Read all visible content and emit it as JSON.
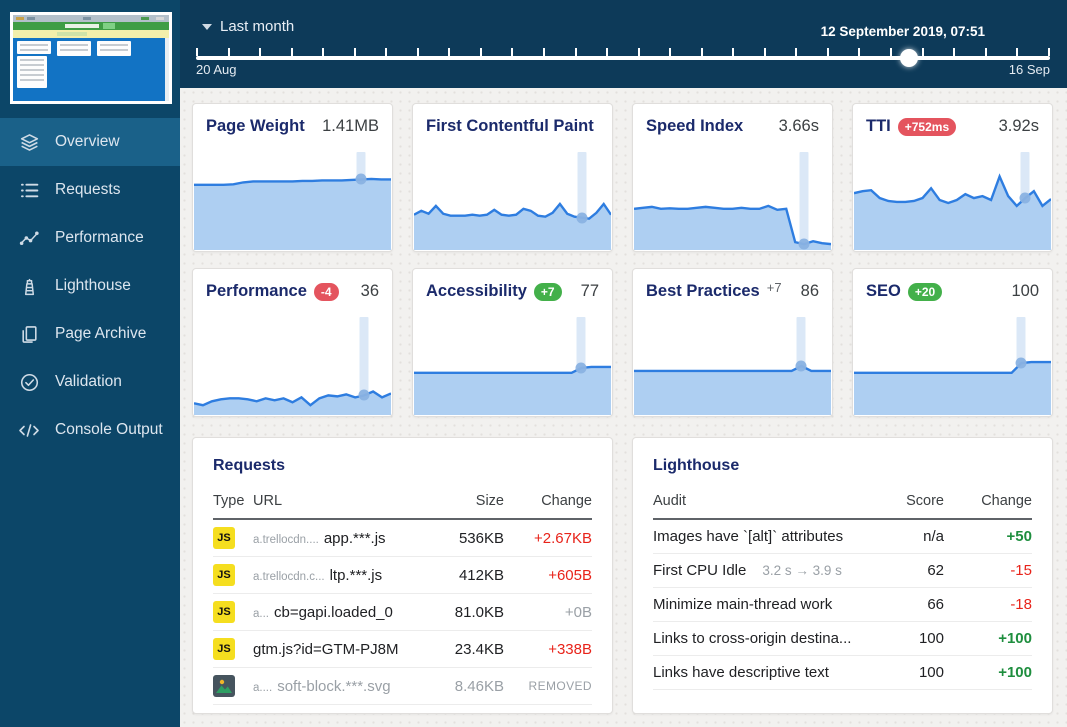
{
  "sidebar": {
    "items": [
      {
        "label": "Overview",
        "icon": "layers-icon",
        "active": true
      },
      {
        "label": "Requests",
        "icon": "list-icon",
        "active": false
      },
      {
        "label": "Performance",
        "icon": "scatter-icon",
        "active": false
      },
      {
        "label": "Lighthouse",
        "icon": "lighthouse-icon",
        "active": false
      },
      {
        "label": "Page Archive",
        "icon": "pages-icon",
        "active": false
      },
      {
        "label": "Validation",
        "icon": "check-circle-icon",
        "active": false
      },
      {
        "label": "Console Output",
        "icon": "code-icon",
        "active": false
      }
    ]
  },
  "header": {
    "range_label": "Last month",
    "current_datetime": "12 September 2019, 07:51",
    "range_start": "20 Aug",
    "range_end": "16 Sep",
    "slider_position_pct": 83.5
  },
  "colors": {
    "sidebar_bg": "#0c4668",
    "sidebar_active_bg": "#1a6189",
    "topbar_bg": "#0d3a59",
    "title_navy": "#1b2a6b",
    "spark_line": "#2e7de0",
    "spark_fill": "#aecff2",
    "badge_red": "#e4545e",
    "badge_green": "#43b04a",
    "change_red": "#e8231a",
    "change_green": "#1e8e3e",
    "js_badge_yellow": "#f5de1f"
  },
  "metric_cards": [
    {
      "title": "Page Weight",
      "value": "1.41MB",
      "badge": null,
      "chart": {
        "values": [
          0.335,
          0.335,
          0.335,
          0.335,
          0.33,
          0.31,
          0.3,
          0.3,
          0.3,
          0.3,
          0.3,
          0.295,
          0.295,
          0.29,
          0.29,
          0.29,
          0.285,
          0.28,
          0.275,
          0.28,
          0.28
        ],
        "marker_index": 17
      }
    },
    {
      "title": "First Contentful Paint",
      "value": "",
      "badge": null,
      "chart": {
        "values": [
          0.64,
          0.6,
          0.63,
          0.55,
          0.63,
          0.65,
          0.65,
          0.65,
          0.64,
          0.65,
          0.64,
          0.59,
          0.64,
          0.65,
          0.64,
          0.58,
          0.6,
          0.65,
          0.66,
          0.62,
          0.53,
          0.63,
          0.66,
          0.67,
          0.68,
          0.62,
          0.53,
          0.64
        ],
        "marker_index": 23
      }
    },
    {
      "title": "Speed Index",
      "value": "3.66s",
      "badge": null,
      "chart": {
        "values": [
          0.58,
          0.57,
          0.56,
          0.58,
          0.575,
          0.58,
          0.58,
          0.57,
          0.56,
          0.57,
          0.58,
          0.58,
          0.57,
          0.58,
          0.58,
          0.55,
          0.59,
          0.58,
          0.92,
          0.94,
          0.91,
          0.93,
          0.94
        ],
        "marker_index": 19
      }
    },
    {
      "title": "TTI",
      "value": "3.92s",
      "badge": {
        "text": "+752ms",
        "style": "red-pill"
      },
      "chart": {
        "values": [
          0.42,
          0.4,
          0.39,
          0.47,
          0.5,
          0.51,
          0.51,
          0.5,
          0.47,
          0.37,
          0.49,
          0.52,
          0.49,
          0.43,
          0.47,
          0.45,
          0.49,
          0.25,
          0.45,
          0.55,
          0.47,
          0.4,
          0.55,
          0.48
        ],
        "marker_index": 20
      }
    },
    {
      "title": "Performance",
      "value": "36",
      "badge": {
        "text": "-4",
        "style": "red-round"
      },
      "chart": {
        "values": [
          0.88,
          0.9,
          0.86,
          0.84,
          0.83,
          0.83,
          0.84,
          0.86,
          0.83,
          0.85,
          0.83,
          0.87,
          0.82,
          0.9,
          0.83,
          0.8,
          0.81,
          0.79,
          0.82,
          0.8,
          0.76,
          0.82,
          0.78
        ],
        "marker_index": 19
      }
    },
    {
      "title": "Accessibility",
      "value": "77",
      "badge": {
        "text": "+7",
        "style": "green-round"
      },
      "chart": {
        "values": [
          0.57,
          0.57,
          0.57,
          0.57,
          0.57,
          0.57,
          0.57,
          0.57,
          0.57,
          0.57,
          0.57,
          0.57,
          0.57,
          0.57,
          0.57,
          0.57,
          0.57,
          0.52,
          0.51,
          0.51,
          0.51
        ],
        "marker_index": 17
      }
    },
    {
      "title": "Best Practices",
      "value": "86",
      "badge": {
        "text": "+7",
        "style": "plain"
      },
      "chart": {
        "values": [
          0.55,
          0.55,
          0.55,
          0.55,
          0.55,
          0.55,
          0.55,
          0.55,
          0.55,
          0.55,
          0.55,
          0.55,
          0.55,
          0.55,
          0.55,
          0.55,
          0.55,
          0.5,
          0.55,
          0.55,
          0.55
        ],
        "marker_index": 17
      }
    },
    {
      "title": "SEO",
      "value": "100",
      "badge": {
        "text": "+20",
        "style": "green-pill"
      },
      "chart": {
        "values": [
          0.57,
          0.57,
          0.57,
          0.57,
          0.57,
          0.57,
          0.57,
          0.57,
          0.57,
          0.57,
          0.57,
          0.57,
          0.57,
          0.57,
          0.57,
          0.57,
          0.57,
          0.47,
          0.46,
          0.46,
          0.46
        ],
        "marker_index": 17
      }
    }
  ],
  "requests_table": {
    "title": "Requests",
    "headers": [
      "Type",
      "URL",
      "Size",
      "Change"
    ],
    "rows": [
      {
        "type_icon": "js-file-icon",
        "type": "js",
        "url_prefix": "a.trellocdn....",
        "url_name": "app.***.js",
        "size": "536KB",
        "change": "+2.67KB",
        "change_style": "negative",
        "muted": false
      },
      {
        "type_icon": "js-file-icon",
        "type": "js",
        "url_prefix": "a.trellocdn.c...",
        "url_name": "ltp.***.js",
        "size": "412KB",
        "change": "+605B",
        "change_style": "negative",
        "muted": false
      },
      {
        "type_icon": "js-file-icon",
        "type": "js",
        "url_prefix": "a...",
        "url_name": "cb=gapi.loaded_0",
        "size": "81.0KB",
        "change": "+0B",
        "change_style": "muted",
        "muted": false
      },
      {
        "type_icon": "js-file-icon",
        "type": "js",
        "url_prefix": "",
        "url_name": "gtm.js?id=GTM-PJ8M",
        "size": "23.4KB",
        "change": "+338B",
        "change_style": "negative",
        "muted": false
      },
      {
        "type_icon": "image-file-icon",
        "type": "image",
        "url_prefix": "a....",
        "url_name": "soft-block.***.svg",
        "size": "8.46KB",
        "change": "REMOVED",
        "change_style": "removed",
        "muted": true
      }
    ]
  },
  "lighthouse_table": {
    "title": "Lighthouse",
    "headers": [
      "Audit",
      "Score",
      "Change"
    ],
    "rows": [
      {
        "audit": "Images have `[alt]` attributes",
        "detail": "",
        "score": "n/a",
        "change": "+50",
        "change_style": "positive"
      },
      {
        "audit": "First CPU Idle",
        "detail": "3.2 s → 3.9 s",
        "score": "62",
        "change": "-15",
        "change_style": "negative"
      },
      {
        "audit": "Minimize main-thread work",
        "detail": "",
        "score": "66",
        "change": "-18",
        "change_style": "negative"
      },
      {
        "audit": "Links to cross-origin destina...",
        "detail": "",
        "score": "100",
        "change": "+100",
        "change_style": "positive"
      },
      {
        "audit": "Links have descriptive text",
        "detail": "",
        "score": "100",
        "change": "+100",
        "change_style": "positive"
      }
    ]
  }
}
